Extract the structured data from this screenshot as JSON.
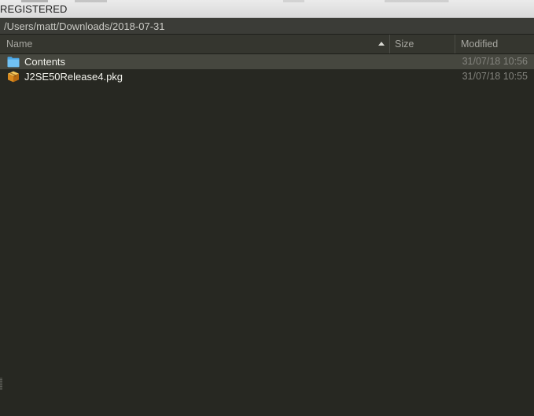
{
  "window": {
    "title": "REGISTERED"
  },
  "pathbar": {
    "path": "/Users/matt/Downloads/2018-07-31"
  },
  "columns": {
    "name": "Name",
    "size": "Size",
    "modified": "Modified",
    "sort_column": "name",
    "sort_direction": "ascending"
  },
  "files": [
    {
      "name": "Contents",
      "type": "folder",
      "icon": "folder-icon",
      "size": "",
      "modified": "31/07/18 10:56",
      "selected": true
    },
    {
      "name": "J2SE50Release4.pkg",
      "type": "package",
      "icon": "package-icon",
      "size": "",
      "modified": "31/07/18 10:55",
      "selected": false
    }
  ],
  "colors": {
    "background": "#272822",
    "header": "#35362f",
    "selected_row": "#46473f",
    "folder": "#62b6ee",
    "package": "#e8a830"
  }
}
